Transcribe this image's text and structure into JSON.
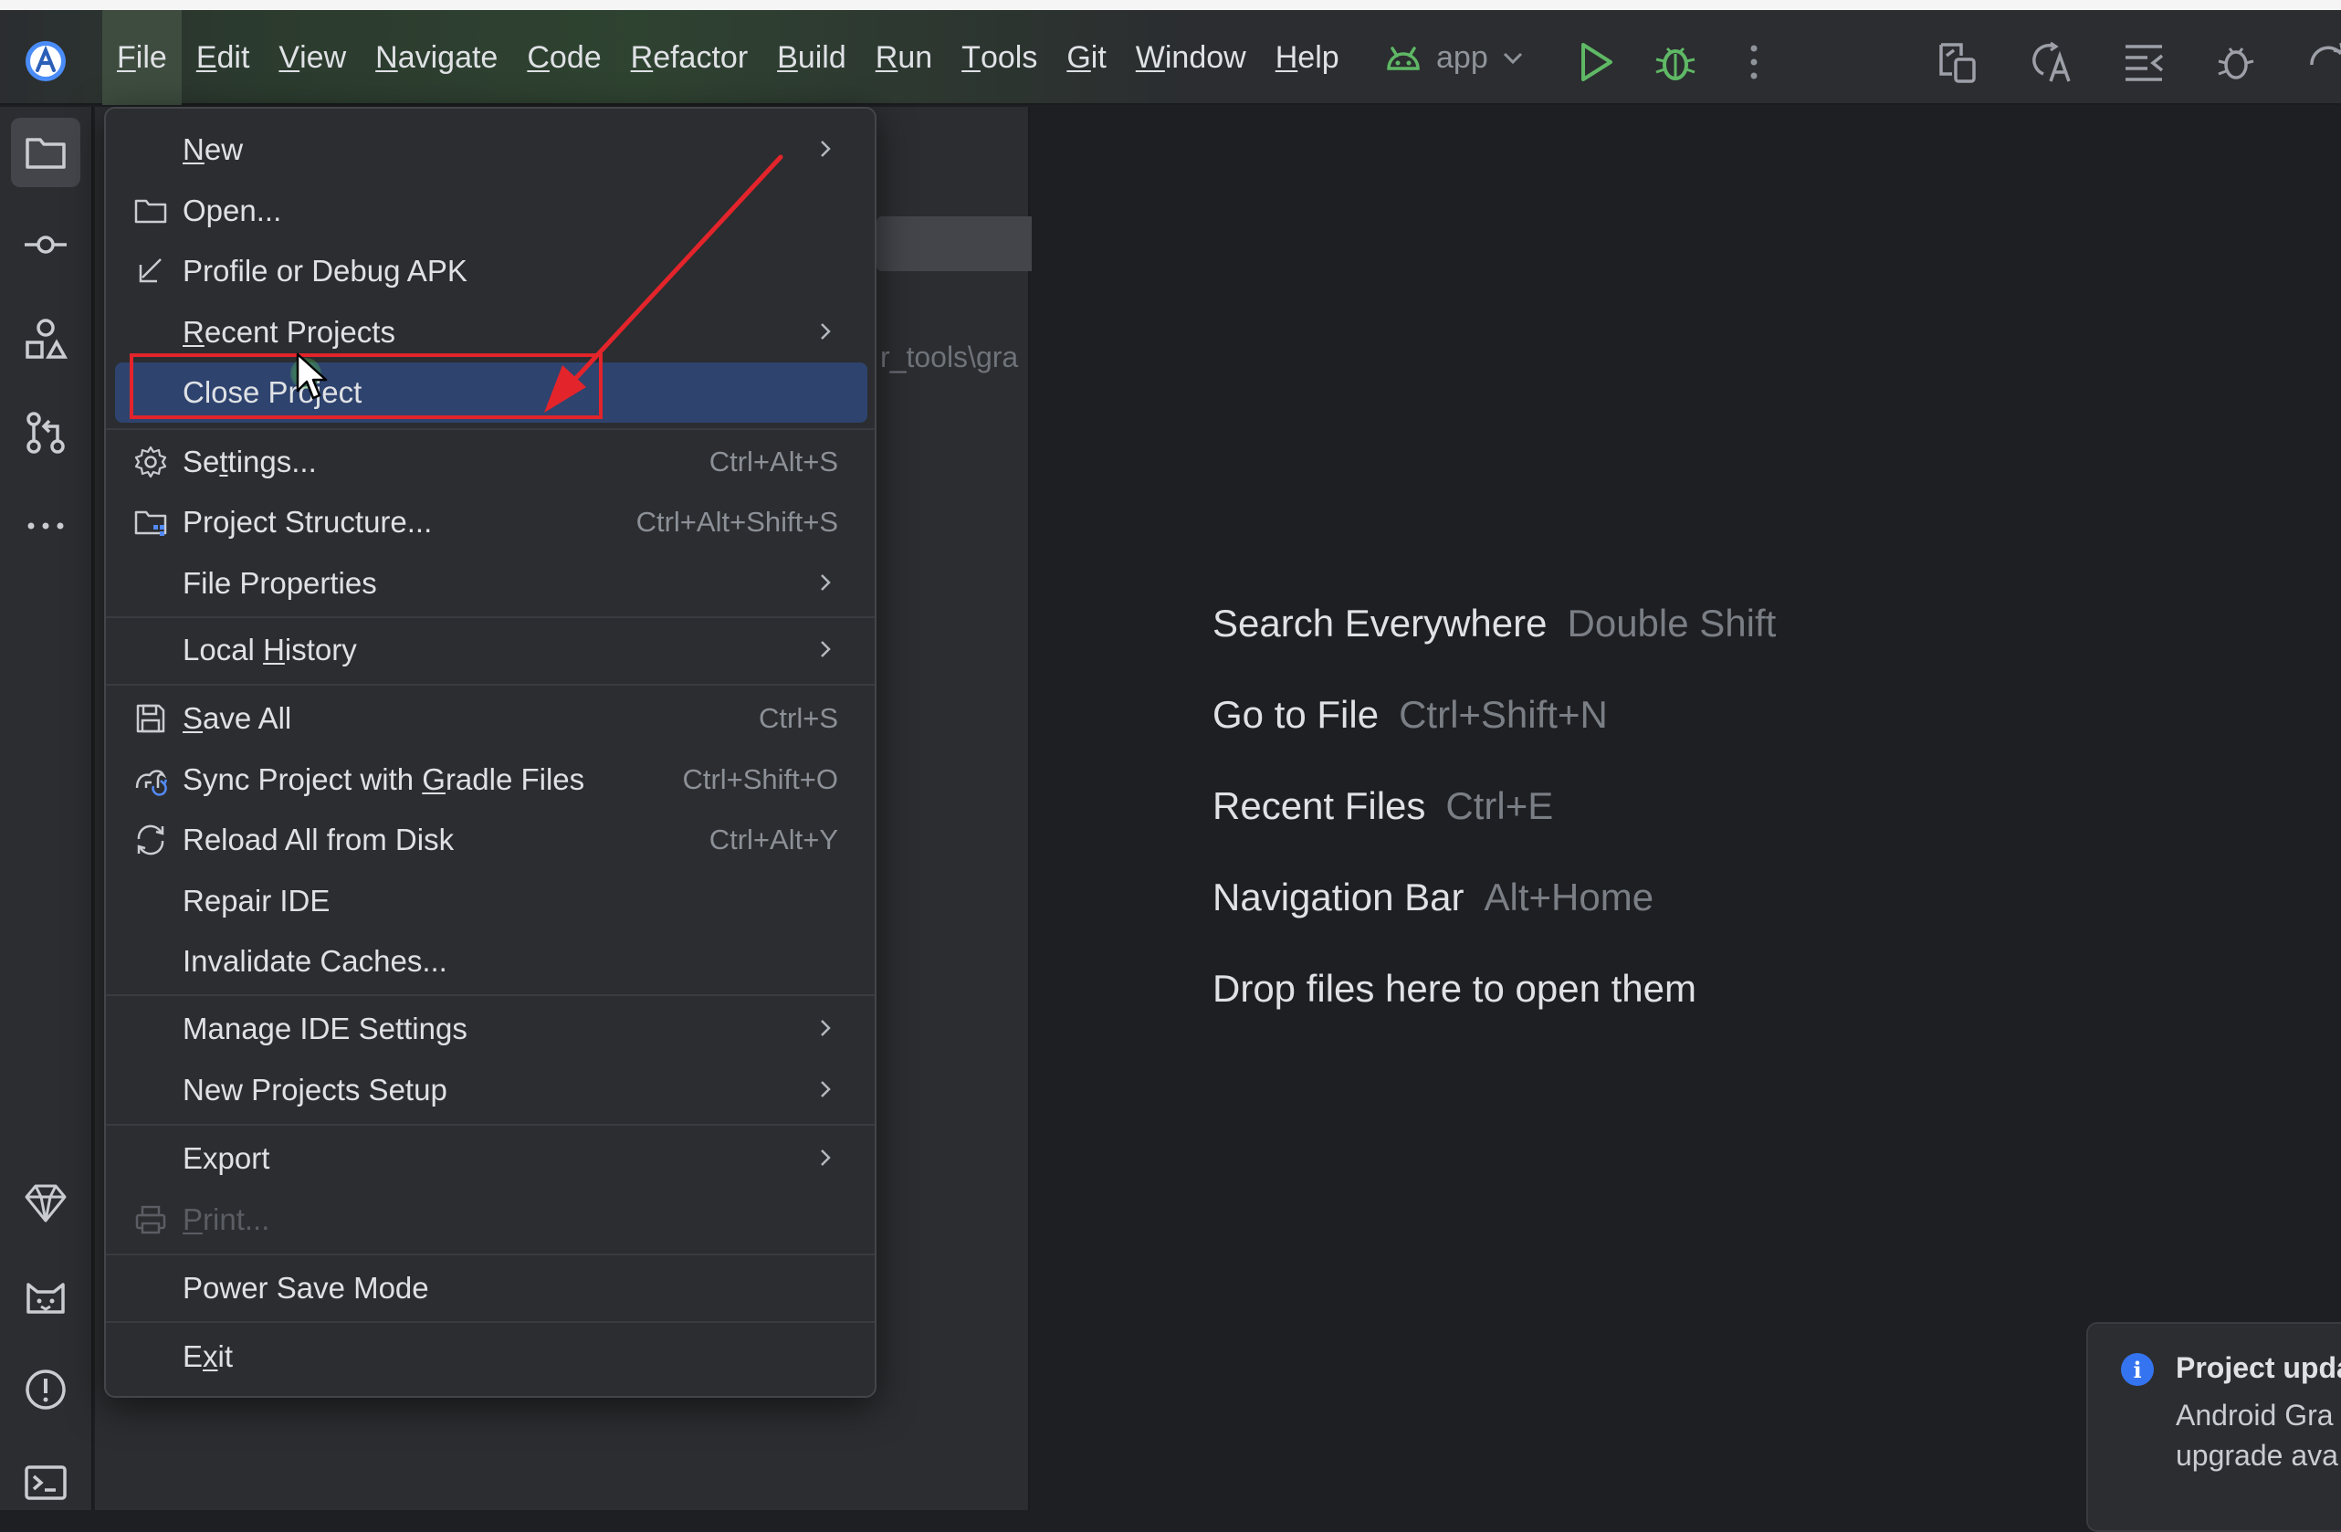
{
  "menubar": {
    "items": [
      {
        "label": "File",
        "mnemonic": "F",
        "rest": "ile",
        "active": true
      },
      {
        "label": "Edit",
        "mnemonic": "E",
        "rest": "dit"
      },
      {
        "label": "View",
        "mnemonic": "V",
        "rest": "iew"
      },
      {
        "label": "Navigate",
        "mnemonic": "N",
        "rest": "avigate"
      },
      {
        "label": "Code",
        "mnemonic": "C",
        "rest": "ode"
      },
      {
        "label": "Refactor",
        "mnemonic": "R",
        "rest": "efactor"
      },
      {
        "label": "Build",
        "mnemonic": "B",
        "rest": "uild"
      },
      {
        "label": "Run",
        "mnemonic": "R",
        "rest": "un"
      },
      {
        "label": "Tools",
        "mnemonic": "T",
        "rest": "ools"
      },
      {
        "label": "Git",
        "mnemonic": "G",
        "rest": "it"
      },
      {
        "label": "Window",
        "mnemonic": "W",
        "rest": "indow"
      },
      {
        "label": "Help",
        "mnemonic": "H",
        "rest": "elp"
      }
    ]
  },
  "toolbar": {
    "run_config": "app",
    "icons": [
      "android-icon",
      "chevron-down-icon",
      "run-icon",
      "debug-icon",
      "more-vertical-icon",
      "device-manager-icon",
      "translate-icon",
      "structure-icon",
      "bug-settings-icon",
      "sync-icon"
    ]
  },
  "left_strip": {
    "icons": [
      "project-folder-icon",
      "commit-icon",
      "resource-manager-icon",
      "pull-requests-icon",
      "more-tools-icon",
      "gem-icon",
      "cat-icon",
      "problems-icon",
      "terminal-icon"
    ]
  },
  "project_panel": {
    "path_fragment": "r_tools\\gra"
  },
  "file_menu": {
    "new": {
      "m": "N",
      "rest": "ew"
    },
    "open": "Open...",
    "profile_debug_apk": "Profile or Debug APK",
    "recent_projects": {
      "m": "R",
      "rest": "ecent Projects"
    },
    "close_project": "Close Project",
    "settings": {
      "pre": "Se",
      "m": "t",
      "rest": "tings...",
      "shortcut": "Ctrl+Alt+S"
    },
    "project_structure": {
      "label": "Project Structure...",
      "shortcut": "Ctrl+Alt+Shift+S"
    },
    "file_properties": "File Properties",
    "local_history": {
      "pre": "Local ",
      "m": "H",
      "rest": "istory"
    },
    "save_all": {
      "m": "S",
      "rest": "ave All",
      "shortcut": "Ctrl+S"
    },
    "sync_gradle": {
      "pre": "Sync Project with ",
      "m": "G",
      "rest": "radle Files",
      "shortcut": "Ctrl+Shift+O"
    },
    "reload_disk": {
      "label": "Reload All from Disk",
      "shortcut": "Ctrl+Alt+Y"
    },
    "repair_ide": "Repair IDE",
    "invalidate_caches": "Invalidate Caches...",
    "manage_ide_settings": "Manage IDE Settings",
    "new_projects_setup": "New Projects Setup",
    "export": "Export",
    "print": {
      "m": "P",
      "rest": "rint..."
    },
    "power_save": "Power Save Mode",
    "exit": {
      "pre": "E",
      "m": "x",
      "rest": "it"
    }
  },
  "editor_hints": [
    {
      "label": "Search Everywhere",
      "keys": "Double Shift"
    },
    {
      "label": "Go to File",
      "keys": "Ctrl+Shift+N"
    },
    {
      "label": "Recent Files",
      "keys": "Ctrl+E"
    },
    {
      "label": "Navigation Bar",
      "keys": "Alt+Home"
    },
    {
      "label": "Drop files here to open them",
      "keys": ""
    }
  ],
  "notification": {
    "title": "Project upda",
    "line1": "Android Gra",
    "line2": "upgrade ava"
  },
  "colors": {
    "accent_selection": "#2e436e",
    "annotation_red": "#e3242b",
    "info_blue": "#3574f0",
    "run_green": "#5fb865"
  }
}
